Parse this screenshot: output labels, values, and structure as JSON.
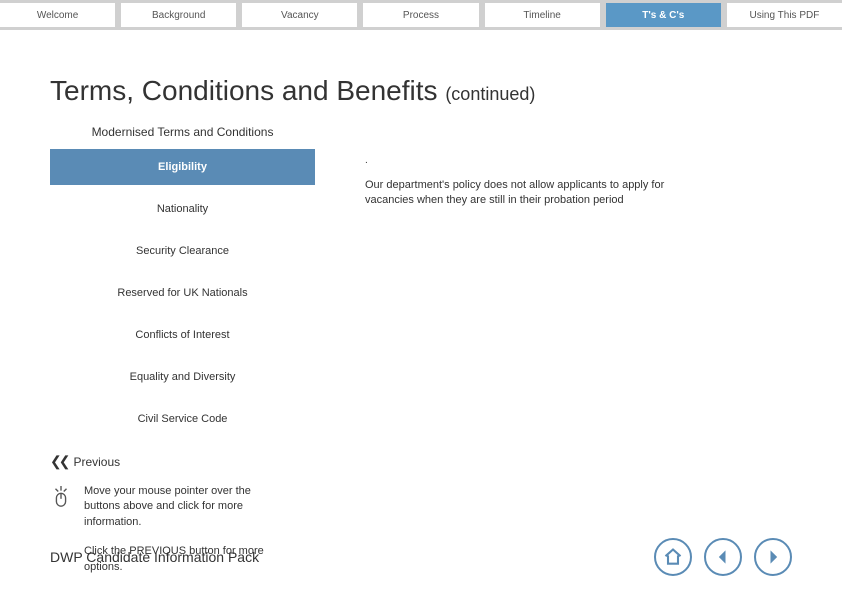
{
  "tabs": [
    {
      "label": "Welcome"
    },
    {
      "label": "Background"
    },
    {
      "label": "Vacancy"
    },
    {
      "label": "Process"
    },
    {
      "label": "Timeline"
    },
    {
      "label": "T's & C's"
    },
    {
      "label": "Using This PDF"
    }
  ],
  "title_main": "Terms, Conditions and Benefits ",
  "title_cont": "(continued)",
  "sidebar": {
    "heading": "Modernised Terms and Conditions",
    "items": [
      {
        "label": "Eligibility"
      },
      {
        "label": "Nationality"
      },
      {
        "label": "Security Clearance"
      },
      {
        "label": "Reserved for UK Nationals"
      },
      {
        "label": "Conflicts of Interest"
      },
      {
        "label": "Equality and Diversity"
      },
      {
        "label": "Civil Service Code"
      }
    ]
  },
  "policy_text": "Our department's policy does not allow applicants to apply for vacancies when they are still in their probation period",
  "prev_label": "Previous",
  "hint1": "Move your mouse pointer over the buttons above and click for more information.",
  "hint2": "Click the PREVIOUS button for more options.",
  "footer_title": "DWP Candidate Information Pack"
}
